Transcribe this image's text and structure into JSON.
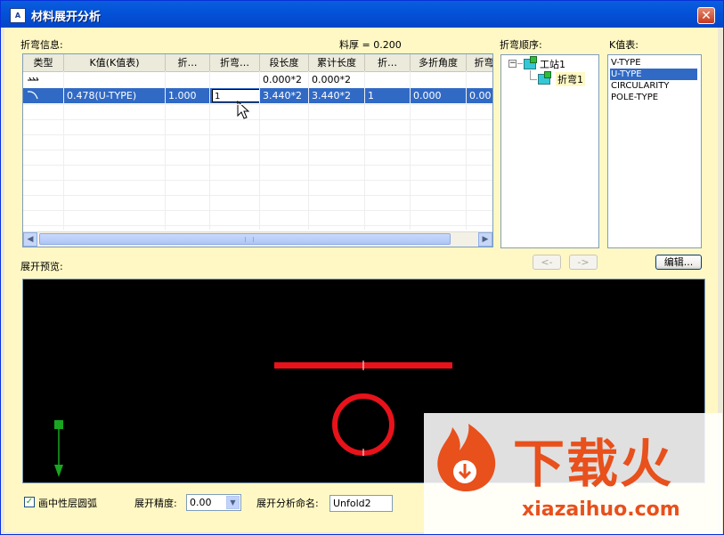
{
  "window": {
    "title": "材料展开分析",
    "icon_text": "A"
  },
  "labels": {
    "bend_info": "折弯信息:",
    "thickness": "料厚 = 0.200",
    "bend_order": "折弯顺序:",
    "k_table": "K值表:",
    "preview": "展开预览:",
    "precision": "展开精度:",
    "analysis_name": "展开分析命名:",
    "middle_arc": "画中性层圆弧"
  },
  "table": {
    "headers": [
      "类型",
      "K值(K值表)",
      "折…",
      "折弯…",
      "段长度",
      "累计长度",
      "折…",
      "多折角度",
      "折弯"
    ],
    "rows": [
      [
        "",
        "",
        "",
        "",
        "0.000*2",
        "0.000*2",
        "",
        "",
        ""
      ],
      [
        "",
        "0.478(U-TYPE)",
        "1.000",
        "",
        "3.440*2",
        "3.440*2",
        "1",
        "0.000",
        "0.00"
      ]
    ],
    "edit_value": "1"
  },
  "tree": {
    "root": "工站1",
    "child": "折弯1",
    "expander": "−"
  },
  "k_list": {
    "items": [
      "V-TYPE",
      "U-TYPE",
      "CIRCULARITY",
      "POLE-TYPE"
    ],
    "selected": "U-TYPE"
  },
  "buttons": {
    "prev": "<-",
    "next": "->",
    "edit": "编辑...",
    "close": "✕"
  },
  "fields": {
    "precision_value": "0.00",
    "name_value": "Unfold2",
    "checkbox_mark": "✓"
  },
  "watermark": {
    "text": "下载火",
    "url": "xiazaihuo.com"
  },
  "colors": {
    "title_bar": "#0453d9",
    "selection": "#316ac5",
    "client_bg": "#fff8c4",
    "preview_bg": "#000000",
    "shape_red": "#e8121b",
    "axis_green": "#18a520",
    "brand_orange": "#e8501c"
  }
}
